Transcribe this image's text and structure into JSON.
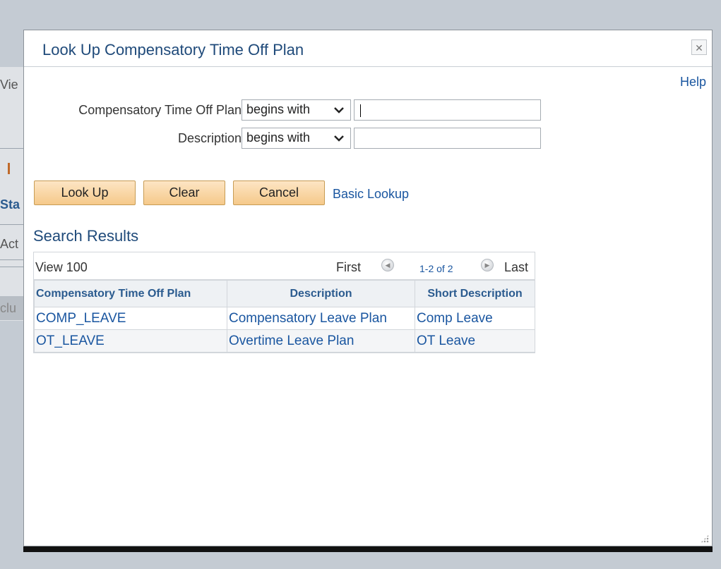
{
  "background": {
    "fragments": [
      "Vie",
      "Sta",
      "Act",
      "clu"
    ]
  },
  "modal": {
    "title": "Look Up Compensatory Time Off Plan",
    "close_icon": "close-icon",
    "help_label": "Help"
  },
  "criteria": [
    {
      "label": "Compensatory Time Off Plan",
      "operator": "begins with",
      "value": ""
    },
    {
      "label": "Description",
      "operator": "begins with",
      "value": ""
    }
  ],
  "buttons": {
    "lookup": "Look Up",
    "clear": "Clear",
    "cancel": "Cancel",
    "basic_lookup": "Basic Lookup"
  },
  "results": {
    "title": "Search Results",
    "view_all": "View 100",
    "first": "First",
    "count": "1-2 of 2",
    "last": "Last",
    "columns": [
      "Compensatory Time Off Plan",
      "Description",
      "Short Description"
    ],
    "rows": [
      [
        "COMP_LEAVE",
        "Compensatory Leave Plan",
        "Comp Leave"
      ],
      [
        "OT_LEAVE",
        "Overtime Leave Plan",
        "OT Leave"
      ]
    ]
  },
  "colors": {
    "title": "#1f4a7a",
    "link": "#1a56a0",
    "button_bg": "#f5c98a",
    "header_bg": "#eef1f4"
  }
}
